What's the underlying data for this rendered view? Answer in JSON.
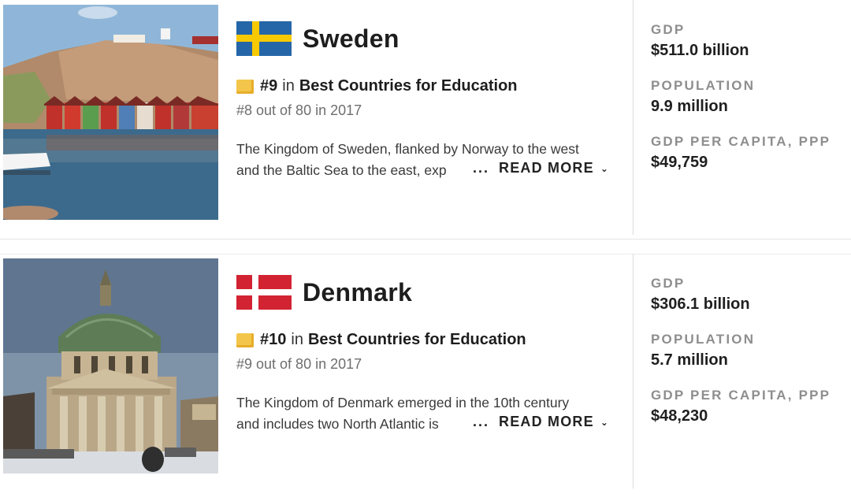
{
  "countries": [
    {
      "name": "Sweden",
      "flag": {
        "icon": "sweden-flag-icon",
        "base": "#2566a8",
        "cross": "#f7c900"
      },
      "rank": {
        "number": "#9",
        "in": "in",
        "category": "Best Countries for Education"
      },
      "previous": "#8 out of 80 in 2017",
      "description": {
        "line1": "The Kingdom of Sweden, flanked by Norway to the west",
        "line2": "and the Baltic Sea to the east, exp"
      },
      "read_more": {
        "dots": "...",
        "label": "READ MORE",
        "icon": "chevron-down-icon"
      },
      "stats": {
        "gdp_label": "GDP",
        "gdp": "$511.0 billion",
        "population_label": "POPULATION",
        "population": "9.9 million",
        "gdp_pc_label": "GDP PER CAPITA, PPP",
        "gdp_pc": "$49,759"
      }
    },
    {
      "name": "Denmark",
      "flag": {
        "icon": "denmark-flag-icon",
        "base": "#d22333",
        "cross": "#ffffff"
      },
      "rank": {
        "number": "#10",
        "in": "in",
        "category": "Best Countries for Education"
      },
      "previous": "#9 out of 80 in 2017",
      "description": {
        "line1": "The Kingdom of Denmark emerged in the 10th century",
        "line2": "and includes two North Atlantic is"
      },
      "read_more": {
        "dots": "...",
        "label": "READ MORE",
        "icon": "chevron-down-icon"
      },
      "stats": {
        "gdp_label": "GDP",
        "gdp": "$306.1 billion",
        "population_label": "POPULATION",
        "population": "5.7 million",
        "gdp_pc_label": "GDP PER CAPITA, PPP",
        "gdp_pc": "$48,230"
      }
    }
  ],
  "colors": {
    "medal": "#f3c54b",
    "label_gray": "#8e8e8e",
    "divider": "#dcdcdc"
  }
}
